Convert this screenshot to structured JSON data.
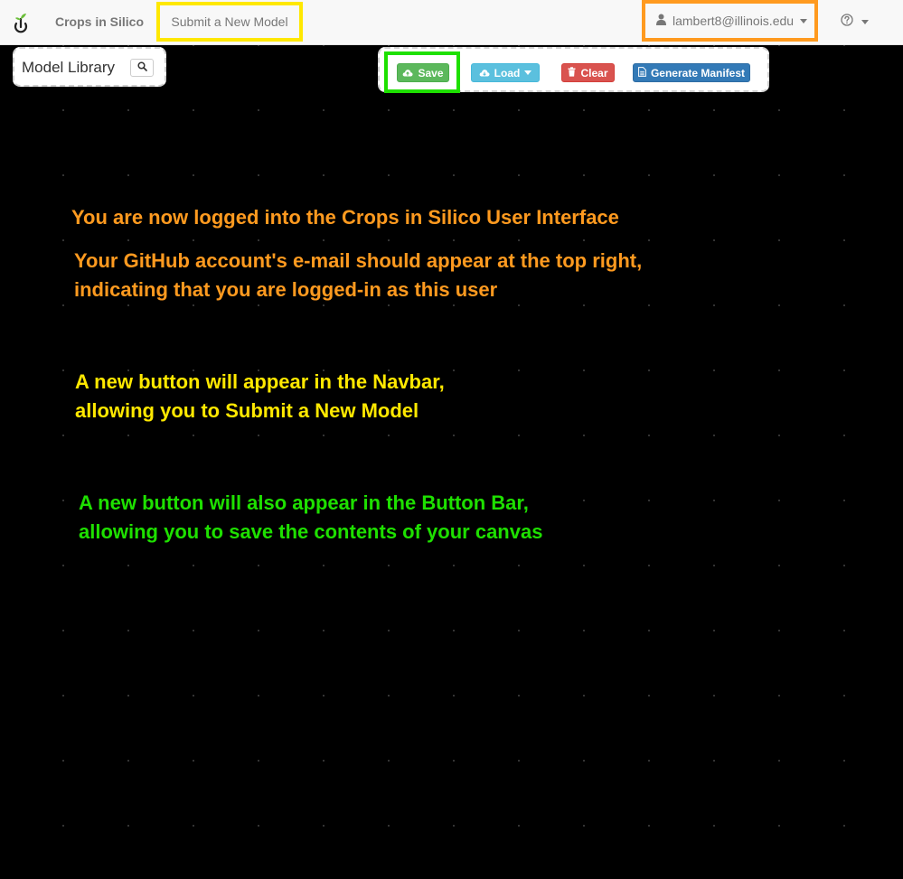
{
  "navbar": {
    "brand": "Crops in Silico",
    "submit_model": "Submit a New Model",
    "user_email": "lambert8@illinois.edu"
  },
  "library": {
    "title": "Model Library"
  },
  "button_bar": {
    "save": "Save",
    "load": "Load",
    "clear": "Clear",
    "manifest": "Generate Manifest"
  },
  "annotations": {
    "logged_in": "You are now logged into the Crops in Silico User Interface",
    "email_line1": "Your GitHub account's e-mail should appear at the top right,",
    "email_line2": "indicating that you are logged-in as this user",
    "navbar_line1": "A new button will appear in the Navbar,",
    "navbar_line2": "allowing you to Submit a New Model",
    "buttonbar_line1": "A new button will also appear in the Button Bar,",
    "buttonbar_line2": "allowing you to save the contents of your canvas"
  },
  "colors": {
    "highlight_orange": "#ff9a1f",
    "highlight_yellow": "#ffe800",
    "highlight_green": "#1ee000",
    "save_green": "#5cb85c",
    "load_blue": "#5bc0de",
    "clear_red": "#d9534f",
    "manifest_blue": "#337ab7"
  },
  "icons": {
    "brand": "power-sprout-icon",
    "user": "user-icon",
    "help": "question-circle-icon",
    "search": "search-icon",
    "save": "cloud-upload-icon",
    "load": "cloud-download-icon",
    "clear": "trash-icon",
    "manifest": "file-icon"
  }
}
